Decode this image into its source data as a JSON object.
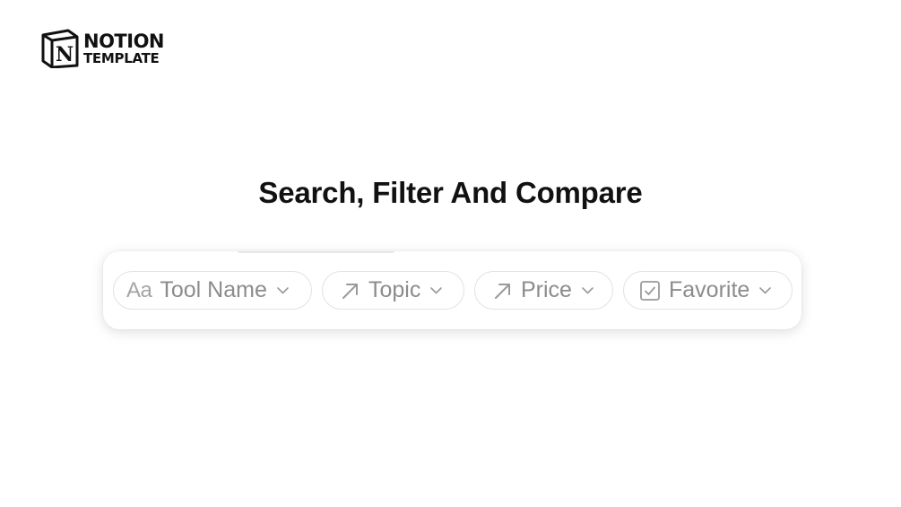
{
  "logo": {
    "line1": "NOTION",
    "line2": "TEMPLATE",
    "mark_letter": "N"
  },
  "headline": "Search, Filter And Compare",
  "filters": [
    {
      "icon": "text-type-icon",
      "icon_text": "Aa",
      "label": "Tool Name"
    },
    {
      "icon": "relation-arrow-icon",
      "label": "Topic"
    },
    {
      "icon": "relation-arrow-icon",
      "label": "Price"
    },
    {
      "icon": "checkbox-icon",
      "label": "Favorite"
    }
  ],
  "colors": {
    "text_dark": "#111111",
    "chip_text": "#8c8c8c",
    "chip_border": "#e2e2e2"
  }
}
